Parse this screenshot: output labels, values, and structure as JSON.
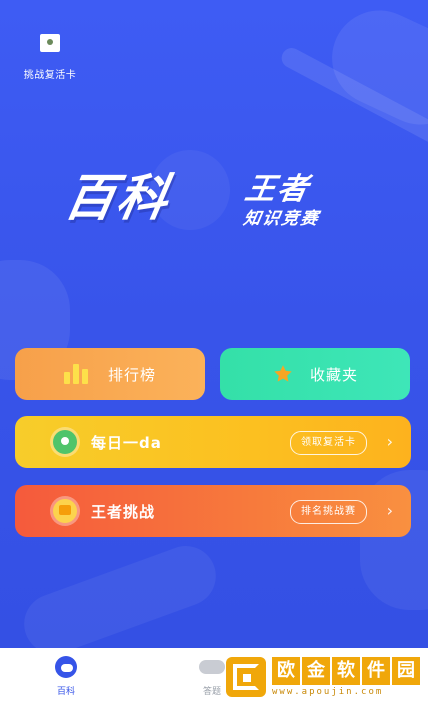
{
  "top": {
    "revive_card_label": "挑战复活卡"
  },
  "logo": {
    "main": "百科",
    "king": "王者",
    "sub": "知识竞赛"
  },
  "buttons": {
    "rank": "排行榜",
    "favorites": "收藏夹",
    "daily": "每日一da",
    "daily_pill": "领取复活卡",
    "king": "王者挑战",
    "king_pill": "排名挑战赛"
  },
  "tabbar": {
    "home": "百科",
    "second": "答题"
  },
  "watermark": {
    "chars": [
      "欧",
      "金",
      "软",
      "件",
      "园"
    ],
    "url": "www.apoujin.com"
  },
  "colors": {
    "background": "#3a55ee",
    "rank_button": "#f7a04a",
    "favorites_button": "#34e0a8",
    "daily_button": "#fcc020",
    "king_button": "#f55a3c",
    "tab_active": "#3654e8",
    "watermark": "#f0a70a"
  },
  "icons": {
    "revive": "card-icon",
    "rank": "bar-chart-icon",
    "favorites": "star-icon",
    "daily": "medal-icon",
    "king": "crown-icon",
    "chevron": "chevron-right-icon",
    "home_tab": "chat-bubble-icon",
    "second_tab": "pill-icon"
  }
}
